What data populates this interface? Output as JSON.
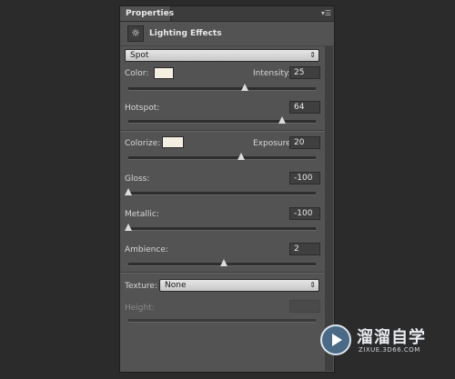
{
  "panel": {
    "tab_label": "Properties",
    "menu_icon": "panel-menu-icon",
    "title": "Lighting Effects",
    "title_icon": "lighting-effects-icon"
  },
  "light_type": {
    "selected": "Spot"
  },
  "color": {
    "label": "Color:",
    "swatch": "#f5efe2"
  },
  "intensity": {
    "label": "Intensity:",
    "value": "25",
    "slider": 0.62
  },
  "hotspot": {
    "label": "Hotspot:",
    "value": "64",
    "slider": 0.82
  },
  "colorize": {
    "label": "Colorize:",
    "swatch": "#f5efe2"
  },
  "exposure": {
    "label": "Exposure:",
    "value": "20",
    "slider": 0.6
  },
  "gloss": {
    "label": "Gloss:",
    "value": "-100",
    "slider": 0.0
  },
  "metallic": {
    "label": "Metallic:",
    "value": "-100",
    "slider": 0.0
  },
  "ambience": {
    "label": "Ambience:",
    "value": "2",
    "slider": 0.51
  },
  "texture": {
    "label": "Texture:",
    "selected": "None"
  },
  "height": {
    "label": "Height:",
    "value": ""
  },
  "watermark": {
    "brand": "溜溜自学",
    "url": "ZIXUE.3D66.COM"
  }
}
